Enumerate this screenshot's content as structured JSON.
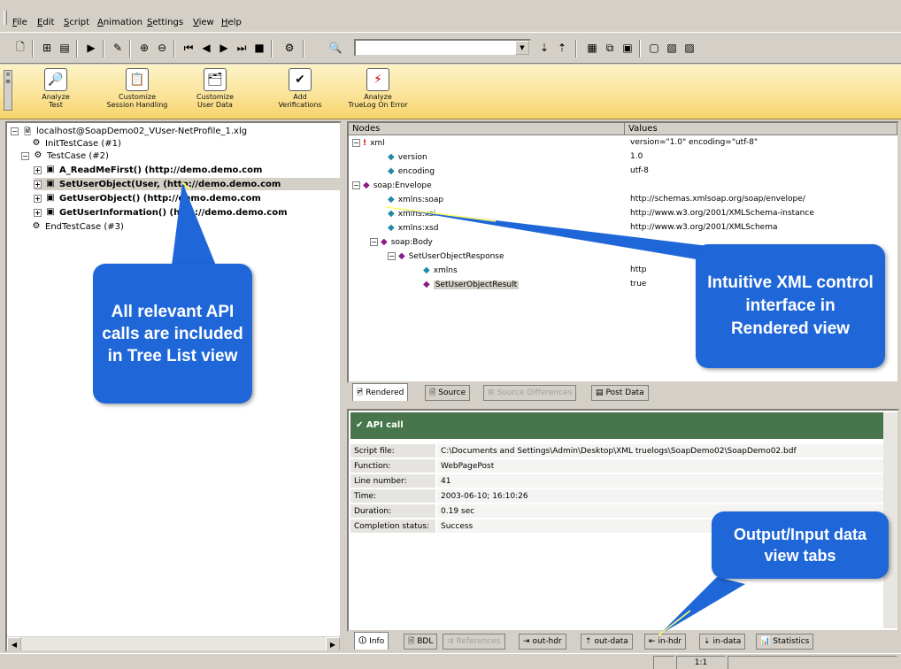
{
  "menu": [
    "File",
    "Edit",
    "Script",
    "Animation",
    "Settings",
    "View",
    "Help"
  ],
  "workflow": [
    {
      "label": "Analyze\nTest",
      "icon": "magnifier-icon"
    },
    {
      "label": "Customize\nSession Handling",
      "icon": "session-icon"
    },
    {
      "label": "Customize\nUser Data",
      "icon": "userdata-icon"
    },
    {
      "label": "Add\nVerifications",
      "icon": "verification-icon"
    },
    {
      "label": "Analyze\nTrueLog On Error",
      "icon": "truelog-error-icon"
    }
  ],
  "tree": {
    "root": "localhost@SoapDemo02_VUser-NetProfile_1.xlg",
    "init": "InitTestCase (#1)",
    "testcase": "TestCase (#2)",
    "calls": [
      "A_ReadMeFirst() (http://demo.demo.com",
      "SetUserObject(User, (http://demo.demo.com",
      "GetUserObject() (http://demo.demo.com",
      "GetUserInformation() (http://demo.demo.com"
    ],
    "end": "EndTestCase (#3)"
  },
  "xml": {
    "col_nodes": "Nodes",
    "col_values": "Values",
    "rows": [
      {
        "node": "xml",
        "value": "version=\"1.0\" encoding=\"utf-8\""
      },
      {
        "node": "version",
        "value": "1.0"
      },
      {
        "node": "encoding",
        "value": "utf-8"
      },
      {
        "node": "soap:Envelope",
        "value": ""
      },
      {
        "node": "xmlns:soap",
        "value": "http://schemas.xmlsoap.org/soap/envelope/"
      },
      {
        "node": "xmlns:xsi",
        "value": "http://www.w3.org/2001/XMLSchema-instance"
      },
      {
        "node": "xmlns:xsd",
        "value": "http://www.w3.org/2001/XMLSchema"
      },
      {
        "node": "soap:Body",
        "value": ""
      },
      {
        "node": "SetUserObjectResponse",
        "value": ""
      },
      {
        "node": "xmlns",
        "value": "http"
      },
      {
        "node": "SetUserObjectResult",
        "value": "true"
      }
    ]
  },
  "view_tabs": [
    "Rendered",
    "Source",
    "Source Differences",
    "Post Data"
  ],
  "info": {
    "title": "API call",
    "rows": [
      {
        "label": "Script file:",
        "value": "C:\\Documents and Settings\\Admin\\Desktop\\XML truelogs\\SoapDemo02\\SoapDemo02.bdf"
      },
      {
        "label": "Function:",
        "value": "WebPagePost"
      },
      {
        "label": "Line number:",
        "value": "41"
      },
      {
        "label": "Time:",
        "value": "2003-06-10; 16:10:26"
      },
      {
        "label": "Duration:",
        "value": "0.19 sec"
      },
      {
        "label": "Completion status:",
        "value": "Success"
      }
    ]
  },
  "bottom_tabs": [
    "Info",
    "BDL",
    "References",
    "out-hdr",
    "out-data",
    "in-hdr",
    "in-data",
    "Statistics"
  ],
  "status": {
    "zoom": "1:1"
  },
  "callouts": {
    "tree": "All relevant API calls are included in Tree List view",
    "xml": "Intuitive XML control interface in Rendered view",
    "tabs": "Output/Input data view tabs"
  },
  "colors": {
    "callout": "#1f67d8",
    "info_header": "#47764c"
  }
}
